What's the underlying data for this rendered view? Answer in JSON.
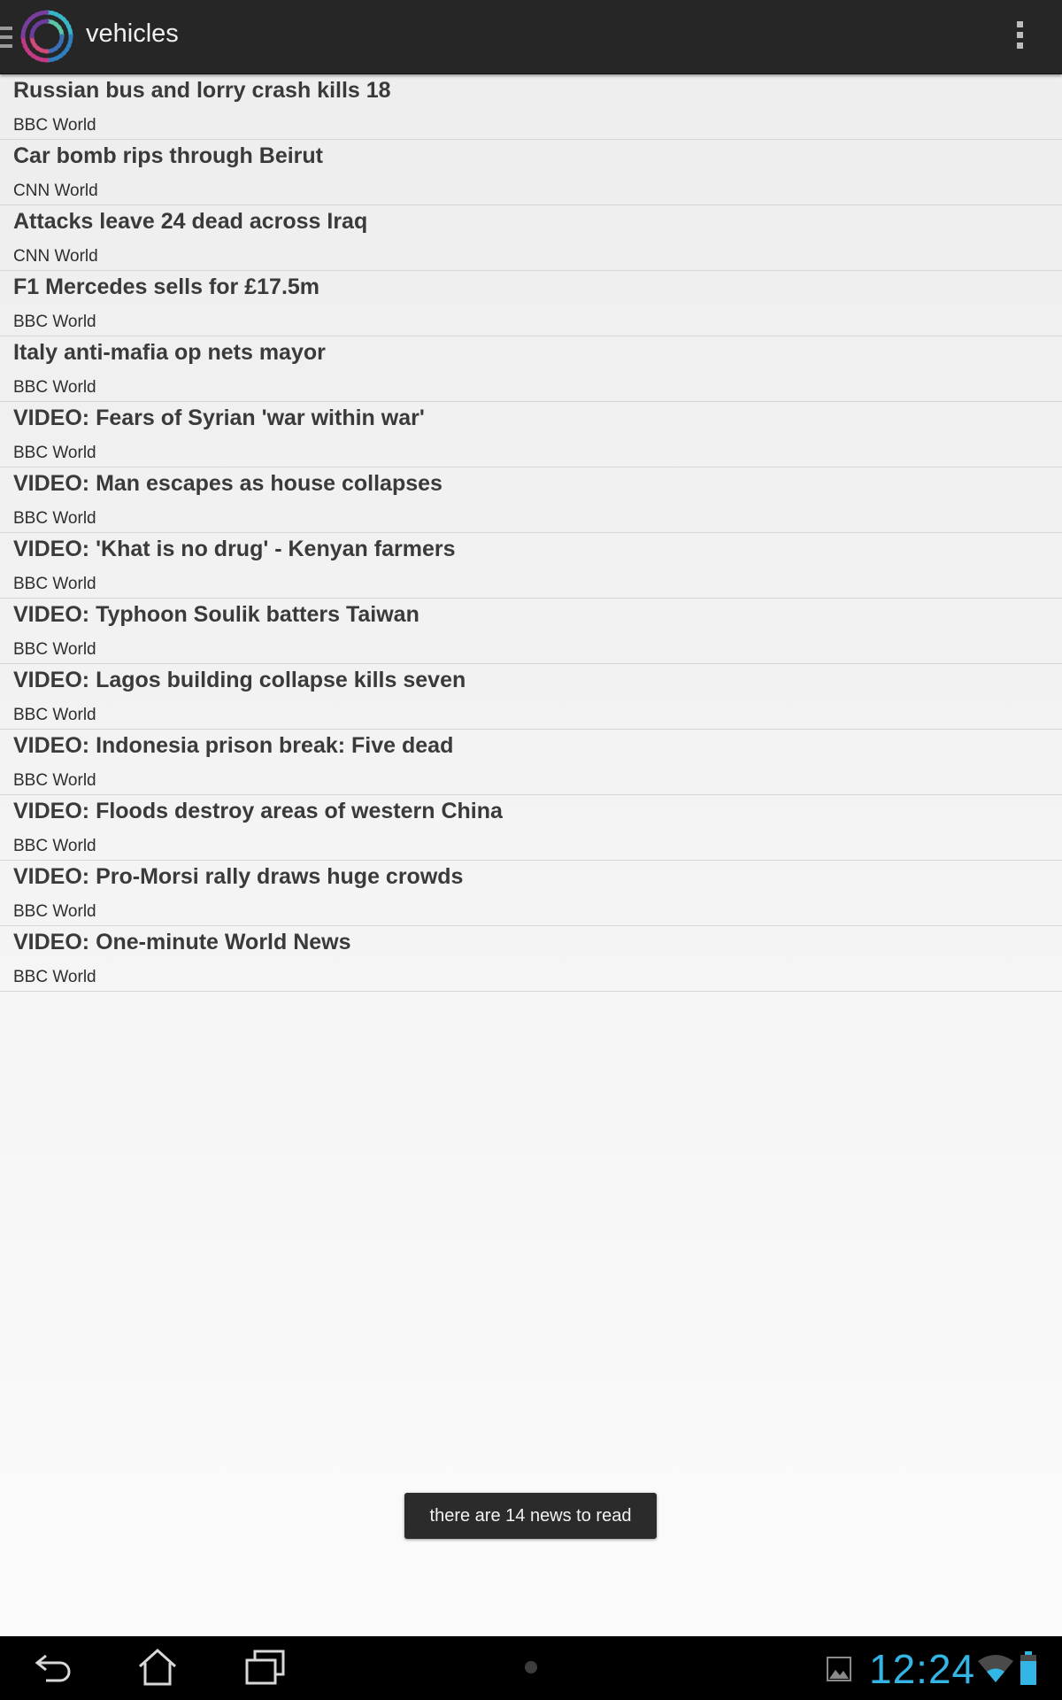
{
  "app": {
    "title": "vehicles"
  },
  "news": [
    {
      "title": "Russian bus and lorry crash kills 18",
      "source": "BBC World"
    },
    {
      "title": "Car bomb rips through Beirut",
      "source": "CNN World"
    },
    {
      "title": "Attacks leave 24 dead across Iraq",
      "source": "CNN World"
    },
    {
      "title": "F1 Mercedes sells for £17.5m",
      "source": "BBC World"
    },
    {
      "title": "Italy anti-mafia op nets mayor",
      "source": "BBC World"
    },
    {
      "title": "VIDEO: Fears of Syrian 'war within war'",
      "source": "BBC World"
    },
    {
      "title": "VIDEO: Man escapes as house collapses",
      "source": "BBC World"
    },
    {
      "title": "VIDEO: 'Khat is no drug' - Kenyan farmers",
      "source": "BBC World"
    },
    {
      "title": "VIDEO: Typhoon Soulik batters Taiwan",
      "source": "BBC World"
    },
    {
      "title": "VIDEO: Lagos building collapse kills seven",
      "source": "BBC World"
    },
    {
      "title": "VIDEO: Indonesia prison break: Five dead",
      "source": "BBC World"
    },
    {
      "title": "VIDEO: Floods destroy areas of western China",
      "source": "BBC World"
    },
    {
      "title": "VIDEO: Pro-Morsi rally draws huge crowds",
      "source": "BBC World"
    },
    {
      "title": "VIDEO: One-minute World News",
      "source": "BBC World"
    }
  ],
  "toast": {
    "message": "there are 14 news to read"
  },
  "status": {
    "time": "12:24"
  },
  "icons": {
    "menu": "hamburger-icon",
    "logo": "app-logo-icon",
    "overflow": "overflow-menu-icon",
    "back": "back-icon",
    "home": "home-icon",
    "recents": "recent-apps-icon",
    "gallery": "gallery-notification-icon",
    "wifi": "wifi-icon",
    "battery": "battery-icon"
  },
  "colors": {
    "accent": "#33b5e5",
    "actionbar": "#262626"
  }
}
